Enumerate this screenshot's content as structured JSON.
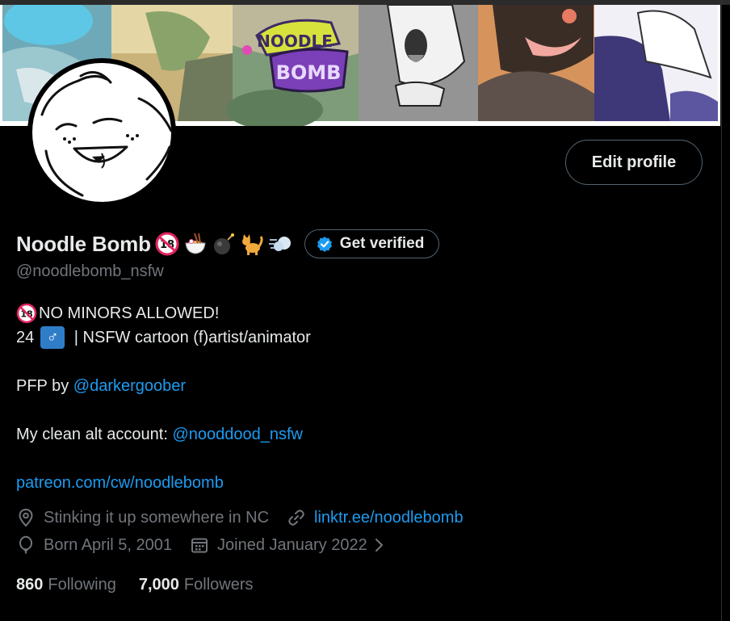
{
  "profile": {
    "display_name": "Noodle Bomb",
    "emojis": [
      "no-under-18-emoji",
      "ramen-emoji",
      "bomb-emoji",
      "cat-emoji",
      "dash-emoji"
    ],
    "handle": "@noodlebomb_nsfw",
    "edit_label": "Edit profile",
    "verify_label": "Get verified",
    "banner_logo_line1": "NOODLE",
    "banner_logo_line2": "BOMB"
  },
  "bio": {
    "line1_text": "NO MINORS ALLOWED!",
    "line2_age": "24",
    "line2_sign": "♂",
    "line2_rest": " | NSFW cartoon (f)artist/animator",
    "pfp_prefix": "PFP by ",
    "pfp_link": "@darkergoober",
    "alt_prefix": "My clean alt account: ",
    "alt_link": "@nooddood_nsfw",
    "patreon_link": "patreon.com/cw/noodlebomb"
  },
  "meta": {
    "location": "Stinking it up somewhere in NC",
    "website": "linktr.ee/noodlebomb",
    "birthday": "Born April 5, 2001",
    "joined": "Joined January 2022"
  },
  "stats": {
    "following_count": "860",
    "following_label": "Following",
    "followers_count": "7,000",
    "followers_label": "Followers"
  },
  "colors": {
    "background": "#000000",
    "text": "#e7e9ea",
    "muted": "#71767b",
    "link": "#1d9bf0",
    "border": "#536471"
  }
}
